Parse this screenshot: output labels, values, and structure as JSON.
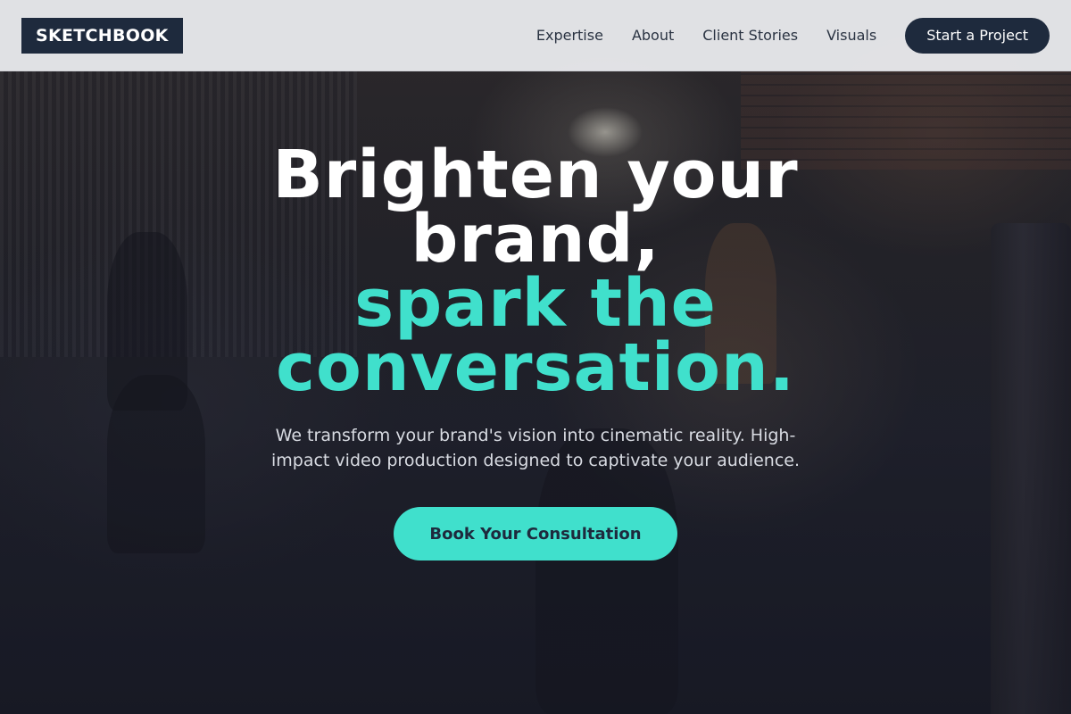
{
  "header": {
    "logo": "SKETCHBOOK",
    "nav": [
      {
        "label": "Expertise"
      },
      {
        "label": "About"
      },
      {
        "label": "Client Stories"
      },
      {
        "label": "Visuals"
      }
    ],
    "cta_label": "Start a Project"
  },
  "hero": {
    "headline_line1": "Brighten your",
    "headline_line2": "brand,",
    "headline_accent1": "spark the",
    "headline_accent2": "conversation.",
    "subtext": "We transform your brand's vision into cinematic reality. High-impact video production designed to captivate your audience.",
    "cta_label": "Book Your Consultation"
  },
  "colors": {
    "accent": "#40e0cc",
    "navy": "#1e2a3d",
    "header_bg": "#e8e9ec"
  }
}
